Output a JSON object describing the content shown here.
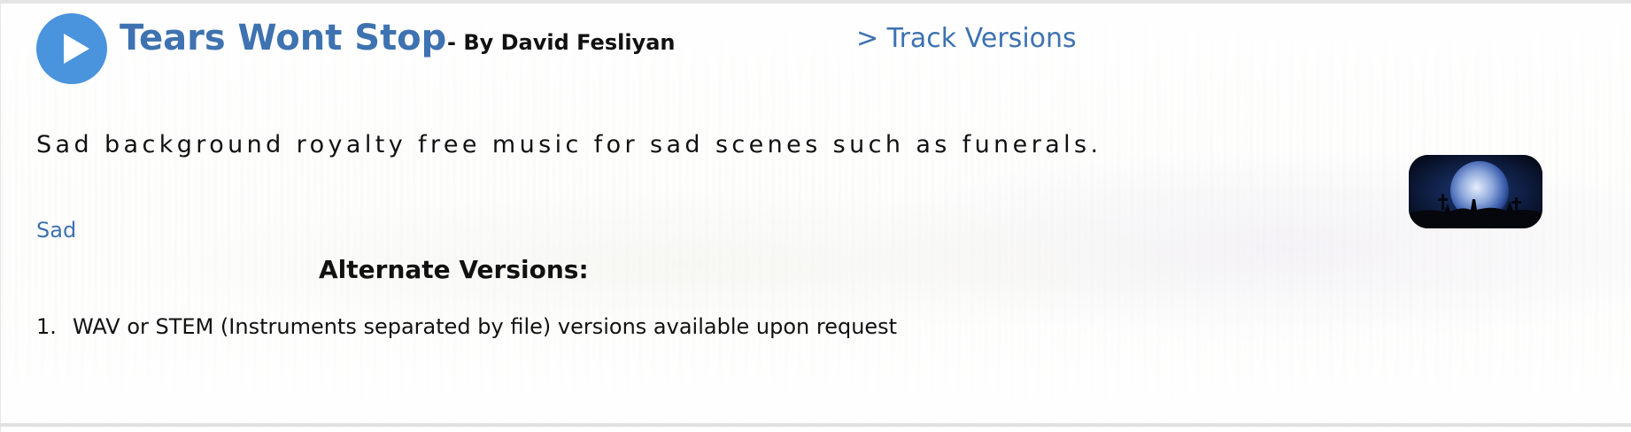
{
  "track": {
    "title": "Tears Wont Stop",
    "byline": "- By David Fesliyan",
    "versions_link": "> Track Versions",
    "description": "Sad background royalty free music for sad scenes such as funerals.",
    "tag": "Sad"
  },
  "play_button": {
    "icon": "play-icon",
    "color": "#4a93dd"
  },
  "thumbnail": {
    "icon": "moon-graveyard-image"
  },
  "alternate_versions": {
    "heading": "Alternate Versions:",
    "items": [
      {
        "number": "1.",
        "text": "WAV or STEM (Instruments separated by file) versions available upon request"
      }
    ]
  },
  "colors": {
    "link": "#3e72b0",
    "text": "#111111"
  }
}
